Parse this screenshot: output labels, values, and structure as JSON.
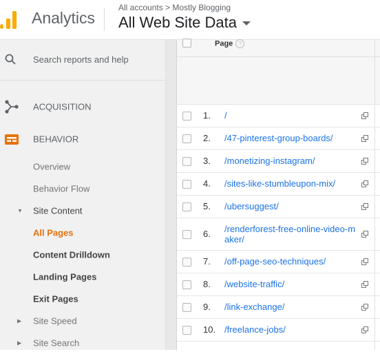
{
  "header": {
    "app_name": "Analytics",
    "breadcrumb": "All accounts > Mostly Blogging",
    "view_name": "All Web Site Data",
    "logo_color": "#f9ab00"
  },
  "sidebar": {
    "search_placeholder": "Search reports and help",
    "acquisition": "ACQUISITION",
    "behavior": "BEHAVIOR",
    "overview": "Overview",
    "behavior_flow": "Behavior Flow",
    "site_content": "Site Content",
    "all_pages": "All Pages",
    "content_drilldown": "Content Drilldown",
    "landing_pages": "Landing Pages",
    "exit_pages": "Exit Pages",
    "site_speed": "Site Speed",
    "site_search": "Site Search",
    "active_color": "#e8710a"
  },
  "table": {
    "column_page": "Page",
    "rows": [
      {
        "rank": "1.",
        "page": "/"
      },
      {
        "rank": "2.",
        "page": "/47-pinterest-group-boards/"
      },
      {
        "rank": "3.",
        "page": "/monetizing-instagram/"
      },
      {
        "rank": "4.",
        "page": "/sites-like-stumbleupon-mix/"
      },
      {
        "rank": "5.",
        "page": "/ubersuggest/"
      },
      {
        "rank": "6.",
        "page": "/renderforest-free-online-video-maker/"
      },
      {
        "rank": "7.",
        "page": "/off-page-seo-techniques/"
      },
      {
        "rank": "8.",
        "page": "/website-traffic/"
      },
      {
        "rank": "9.",
        "page": "/link-exchange/"
      },
      {
        "rank": "10.",
        "page": "/freelance-jobs/"
      }
    ]
  }
}
